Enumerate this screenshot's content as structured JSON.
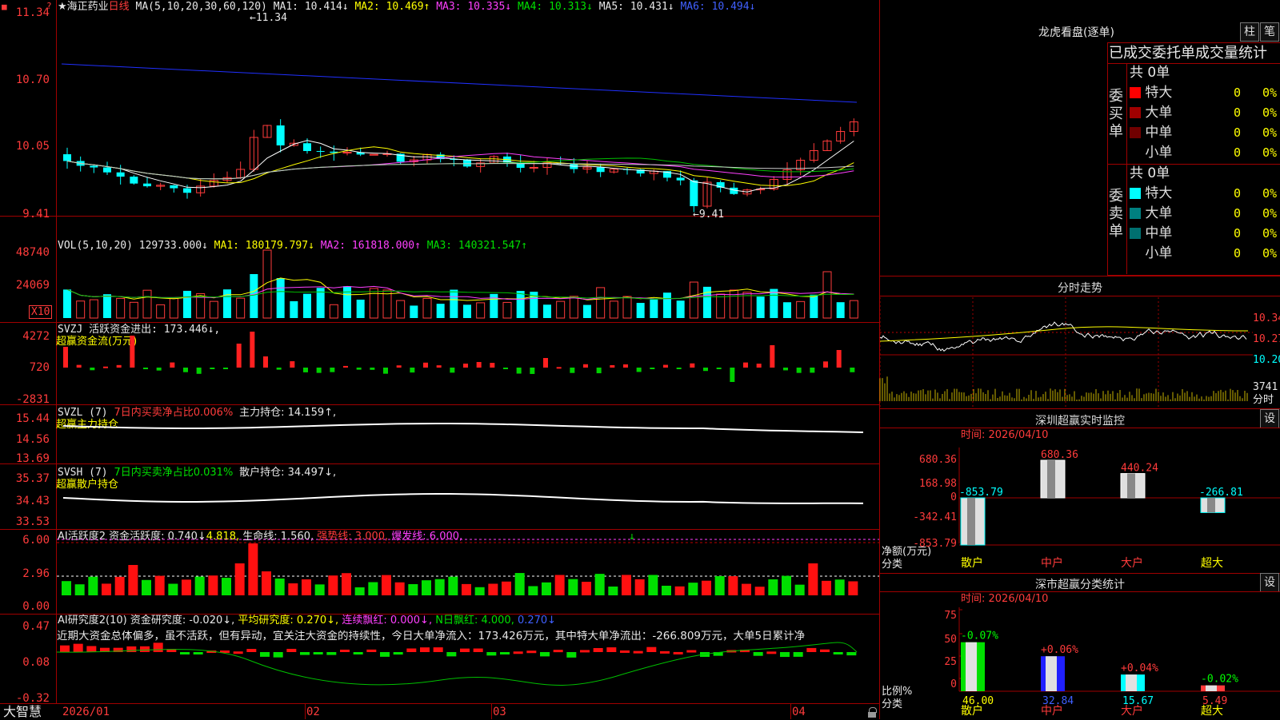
{
  "main": {
    "name": "★海正药业",
    "period": "日线",
    "ma_legend": "MA(5,10,20,30,60,120)",
    "ma": [
      "MA1: 10.414↓",
      "MA2: 10.469↑",
      "MA3: 10.335↓",
      "MA4: 10.313↓",
      "MA5: 10.431↓",
      "MA6: 10.494↓"
    ],
    "yaxis": [
      "11.34",
      "10.70",
      "10.05",
      "9.41"
    ],
    "high_label": "11.34",
    "low_label": "9.41",
    "close_icon": "close-icon"
  },
  "vol": {
    "legend": "VOL(5,10,20)",
    "value": "129733.000↓",
    "ma1": "MA1: 180179.797↓",
    "ma2": "MA2: 161818.000↑",
    "ma3": "MA3: 140321.547↑",
    "yaxis": [
      "48740",
      "24069"
    ],
    "unit": "X10"
  },
  "svzj": {
    "legend": "SVZJ  活跃资金进出: 173.446↓,",
    "title": "超赢资金流(万元)",
    "yaxis": [
      "4272",
      "720",
      "-2831"
    ]
  },
  "svzl": {
    "legend": "SVZL (7)",
    "net": "7日内买卖净占比0.006%",
    "hold": "主力持仓: 14.159↑,",
    "title": "超赢主力持仓",
    "yaxis": [
      "15.44",
      "14.56",
      "13.69"
    ]
  },
  "svsh": {
    "legend": "SVSH (7)",
    "net": "7日内买卖净占比0.031%",
    "hold": "散户持仓: 34.497↓,",
    "title": "超赢散户持仓",
    "yaxis": [
      "35.37",
      "34.43",
      "33.53"
    ]
  },
  "ai1": {
    "legend": "AI活跃度2",
    "act": "资金活跃度: 0.740↓",
    "v2": "4.818,",
    "life": "生命线: 1.560,",
    "strong": "强势线: 3.000,",
    "burst": "爆发线: 6.000,",
    "arrow": "↓",
    "yaxis": [
      "6.00",
      "2.96",
      "0.00"
    ]
  },
  "ai2": {
    "legend": "AI研究度2(10)",
    "res": "资金研究度: -0.020↓,",
    "avg": "平均研究度: 0.270↓,",
    "cont": "连续飘红: 0.000↓,",
    "nday": "N日飘红: 4.000,",
    "last": "0.270↓",
    "text": "近期大资金总体偏多，虽不活跃，但有异动，宜关注大资金的持续性，今日大单净流入：173.426万元，其中特大单净流出：-266.809万元，大单5日累计净",
    "yaxis": [
      "0.47",
      "0.08",
      "-0.32"
    ]
  },
  "xaxis": [
    "2026/01",
    "02",
    "03",
    "04"
  ],
  "brand": "大智慧",
  "lhb": {
    "title": "龙虎看盘(逐单)",
    "btn_zhu": "柱",
    "btn_bi": "笔",
    "subtitle": "已成交委托单成交量统计",
    "buy_label": "委买单",
    "sell_label": "委卖单",
    "buy_total": "共 0单",
    "sell_total": "共 0单",
    "buy_rows": [
      {
        "name": "特大",
        "count": "0",
        "pct": "0%",
        "color": "#ff0000"
      },
      {
        "name": "大单",
        "count": "0",
        "pct": "0%",
        "color": "#a00000"
      },
      {
        "name": "中单",
        "count": "0",
        "pct": "0%",
        "color": "#700000"
      },
      {
        "name": "小单",
        "count": "0",
        "pct": "0%",
        "color": ""
      }
    ],
    "sell_rows": [
      {
        "name": "特大",
        "count": "0",
        "pct": "0%",
        "color": "#00ffff"
      },
      {
        "name": "大单",
        "count": "0",
        "pct": "0%",
        "color": "#008080"
      },
      {
        "name": "中单",
        "count": "0",
        "pct": "0%",
        "color": "#007070"
      },
      {
        "name": "小单",
        "count": "0",
        "pct": "0%",
        "color": ""
      }
    ]
  },
  "intraday": {
    "title": "分时走势",
    "yaxis": [
      "10.34",
      "10.27",
      "10.20"
    ],
    "vol": "3741",
    "vol_unit": "分时"
  },
  "sz_monitor": {
    "title": "深圳超赢实时监控",
    "btn": "设",
    "time": "时间: 2026/04/10",
    "yaxis": [
      "680.36",
      "168.98",
      "0",
      "-342.41",
      "-853.79"
    ],
    "ylabel1": "净额(万元)",
    "ylabel2": "分类",
    "categories": [
      "散户",
      "中户",
      "大户",
      "超大"
    ],
    "values": [
      "-853.79",
      "680.36",
      "440.24",
      "-266.81"
    ]
  },
  "sz_class": {
    "title": "深市超赢分类统计",
    "btn": "设",
    "time": "时间: 2026/04/10",
    "yaxis": [
      "75",
      "50",
      "25",
      "0"
    ],
    "ylabel1": "比例%",
    "ylabel2": "分类",
    "categories": [
      "散户",
      "中户",
      "大户",
      "超大"
    ],
    "values": [
      "46.00",
      "32.84",
      "15.67",
      "5.49"
    ],
    "changes": [
      "-0.07%",
      "+0.06%",
      "+0.04%",
      "-0.02%"
    ]
  }
}
